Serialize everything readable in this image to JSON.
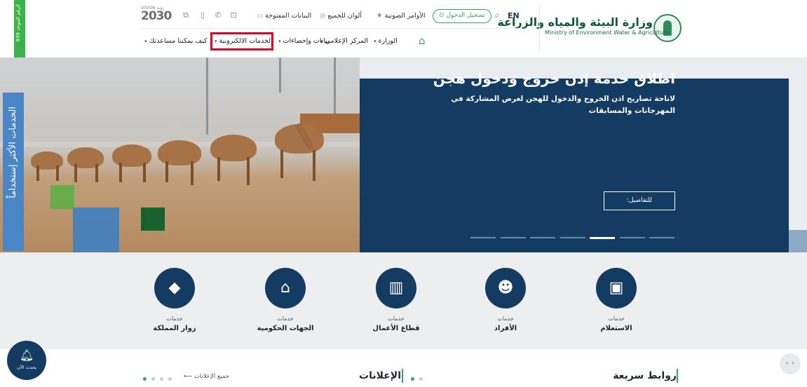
{
  "header": {
    "ministry_ar": "وزارة البيئة والمياه والزراعة",
    "ministry_en": "Ministry of Environment Water & Agriculture",
    "lang": "EN",
    "login": "تسجيل الدخول",
    "voice_commands": "الأوامر الصوتية",
    "colors_for_all": "ألوان للجميع",
    "open_data": "البيانات المفتوحة",
    "vision_top": "VISION رؤية",
    "vision_num": "2030"
  },
  "nav": {
    "ministry": "الوزارة",
    "media_center": "المركز الإعلامي",
    "data_stats": "بيانات وإحصاءات",
    "eservices": "الخدمات الالكترونية",
    "how_help": "كيف يمكننا مساعدتك"
  },
  "side": {
    "unified_number": "الرقم الموحد 939",
    "most_used": "الخدمات الأكثر إستخداماً"
  },
  "hero": {
    "title": "اطلاق خدمة إذن خروج ودخول هجن",
    "subtitle": "لاتاحة تصاريح اذن الخروج والدخول للهجن لغرض المشاركة في المهرجانات والمسابقات",
    "details": "للتفاصيل:",
    "slides": 7,
    "active_slide": 5
  },
  "services": {
    "prefix": "خدمات",
    "items": [
      {
        "label": "الاستعلام",
        "icon": "passport-icon",
        "glyph": "▣"
      },
      {
        "label": "الأفراد",
        "icon": "people-icon",
        "glyph": "☻"
      },
      {
        "label": "قطاع الأعمال",
        "icon": "building-icon",
        "glyph": "▥"
      },
      {
        "label": "الجهات الحكومية",
        "icon": "government-icon",
        "glyph": "⌂"
      },
      {
        "label": "زوار المملكة",
        "icon": "saudi-map-icon",
        "glyph": "◆"
      }
    ]
  },
  "bottom": {
    "quick_links": "روابط سريعة",
    "announcements": "الإعلانات",
    "all_announcements": "جميع الإعلانات",
    "notify_now": "يحدث الآن"
  },
  "colors": {
    "green": "#37a65a",
    "navy": "#143b62",
    "blue": "#4a86c5",
    "highlight": "#e3001b"
  }
}
